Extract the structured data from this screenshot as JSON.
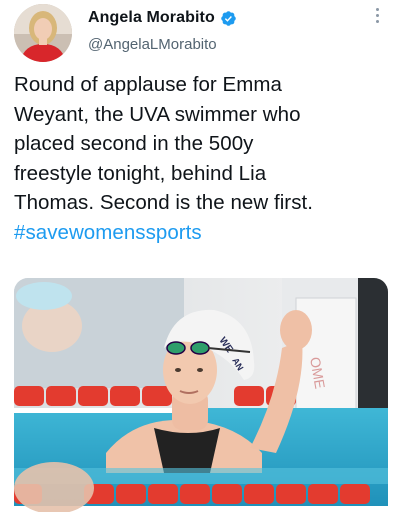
{
  "author": {
    "display_name": "Angela Morabito",
    "handle": "@AngelaLMorabito",
    "verified": true,
    "avatar_icon": "profile-photo"
  },
  "tweet": {
    "line1": "Round of applause for Emma",
    "line2": "Weyant, the UVA swimmer who",
    "line3": "placed second in the 500y",
    "line4": "freestyle tonight, behind Lia",
    "line5": "Thomas. Second is the new first.",
    "hashtag": "#savewomenssports"
  },
  "media": {
    "description_icon": "swimmer-photo",
    "cap_text": "WE",
    "cap_text2": "AN"
  },
  "colors": {
    "accent": "#1d9bf0",
    "text": "#0f1419",
    "secondary": "#536471"
  }
}
